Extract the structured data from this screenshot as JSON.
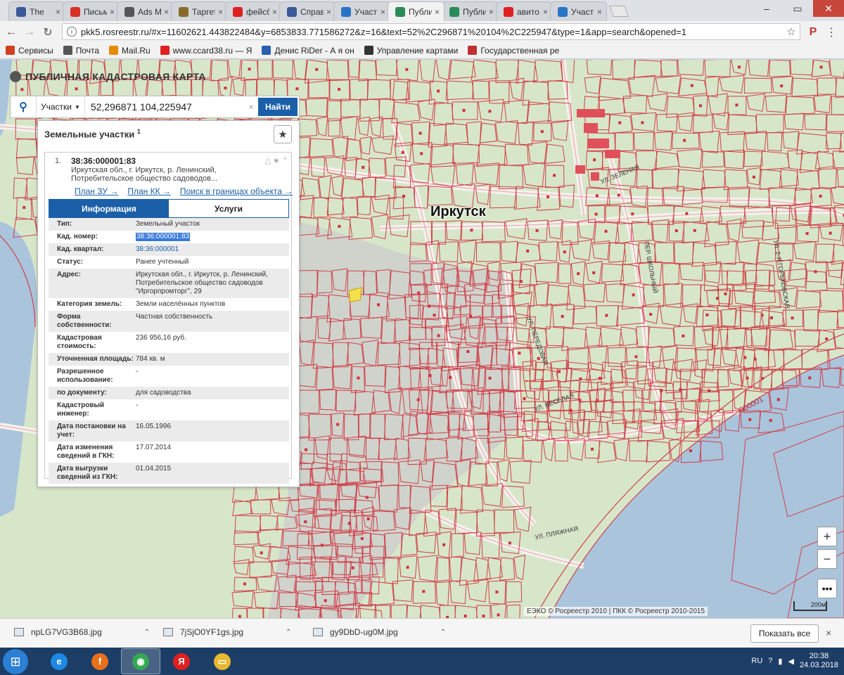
{
  "browser": {
    "tabs": [
      {
        "label": "The",
        "color": "#3b5998"
      },
      {
        "label": "Письм",
        "color": "#d93025"
      },
      {
        "label": "Ads M",
        "color": "#555555"
      },
      {
        "label": "Таргет",
        "color": "#8a6a2a"
      },
      {
        "label": "фейсб",
        "color": "#e02020"
      },
      {
        "label": "Справ",
        "color": "#3b5998"
      },
      {
        "label": "Участ",
        "color": "#2a74c8"
      },
      {
        "label": "Публи",
        "color": "#2a8a5a"
      },
      {
        "label": "Публи",
        "color": "#2a8a5a"
      },
      {
        "label": "авито",
        "color": "#e02020"
      },
      {
        "label": "Участ",
        "color": "#2a74c8"
      }
    ],
    "url": "pkk5.rosreestr.ru/#x=11602621.443822484&y=6853833.771586272&z=16&text=52%2C296871%20104%2C225947&type=1&app=search&opened=1",
    "bookmarks": [
      {
        "label": "Сервисы",
        "color": "#d04020"
      },
      {
        "label": "Почта",
        "color": "#555555"
      },
      {
        "label": "Mail.Ru",
        "color": "#e88a00"
      },
      {
        "label": "www.ccard38.ru — Я",
        "color": "#e02020"
      },
      {
        "label": "Денис RiDer - А я он",
        "color": "#2a5fb0"
      },
      {
        "label": "Управление картами",
        "color": "#333333"
      },
      {
        "label": "Государственная ре",
        "color": "#c03030"
      }
    ]
  },
  "map": {
    "title": "ПУБЛИЧНАЯ КАДАСТРОВАЯ КАРТА",
    "city": "Иркутск",
    "river_label": "000001",
    "attribution": "ЕЭКО © Росреестр 2010 | ПКК © Росреестр 2010-2015",
    "scale": "200м",
    "zoom_in": "+",
    "zoom_out": "−",
    "more": "•••",
    "streets": [
      "УЛ. ВЕСЕЛАЯ",
      "УЛ. ПЛЯЖНАЯ",
      "УЛ. 2-Я ГОРЬКОВСКАЯ",
      "ПЕР. ШКОЛЬНЫЙ",
      "УЛ. ПЕРЕДОВАЯ",
      "УЛ. ЗЕЛЕНАЯ"
    ]
  },
  "search": {
    "type": "Участки",
    "query": "52,296871 104,225947",
    "button": "Найти",
    "clear": "×"
  },
  "panel": {
    "heading": "Земельные участки",
    "count": "1",
    "result": {
      "index": "1.",
      "number": "38:36:000001:83",
      "address": "Иркутская обл., г. Иркутск, р. Ленинский, Потребительское общество садоводов...",
      "links": [
        "План ЗУ →",
        "План КК →",
        "Поиск в границах объекта →"
      ]
    },
    "tabs": [
      "Информация",
      "Услуги"
    ],
    "attributes": [
      {
        "k": "Тип:",
        "v": "Земельный участок"
      },
      {
        "k": "Кад. номер:",
        "v": "38:36:000001:83"
      },
      {
        "k": "Кад. квартал:",
        "v": "38:36:000001"
      },
      {
        "k": "Статус:",
        "v": "Ранее учтенный"
      },
      {
        "k": "Адрес:",
        "v": "Иркутская обл., г. Иркутск, р. Ленинский, Потребительское общество садоводов \"Иргорпромторг\", 29"
      },
      {
        "k": "Категория земель:",
        "v": "Земли населённых пунктов"
      },
      {
        "k": "Форма собственности:",
        "v": "Частная собственность"
      },
      {
        "k": "Кадастровая стоимость:",
        "v": "236 956,16 руб."
      },
      {
        "k": "Уточненная площадь:",
        "v": "784 кв. м"
      },
      {
        "k": "Разрешенное использование:",
        "v": "-"
      },
      {
        "k": "по документу:",
        "v": "для садоводства"
      },
      {
        "k": "Кадастровый инженер:",
        "v": "-"
      },
      {
        "k": "Дата постановки на учет:",
        "v": "16.05.1996"
      },
      {
        "k": "Дата изменения сведений в ГКН:",
        "v": "17.07.2014"
      },
      {
        "k": "Дата выгрузки сведений из ГКН:",
        "v": "01.04.2015"
      }
    ]
  },
  "downloads": {
    "files": [
      "npLG7VG3B68.jpg",
      "7jSjO0YF1gs.jpg",
      "gy9DbD-ug0M.jpg"
    ],
    "show_all": "Показать все",
    "close": "×"
  },
  "taskbar": {
    "lang": "RU",
    "time": "20:38",
    "date": "24.03.2018",
    "apps": [
      {
        "name": "ie",
        "color": "#1e88e5",
        "glyph": "e"
      },
      {
        "name": "firefox",
        "color": "#e8701a",
        "glyph": "f"
      },
      {
        "name": "chrome",
        "color": "#34a853",
        "glyph": "◉"
      },
      {
        "name": "yandex",
        "color": "#e02020",
        "glyph": "Я"
      },
      {
        "name": "explorer",
        "color": "#e8b830",
        "glyph": "▭"
      }
    ]
  }
}
